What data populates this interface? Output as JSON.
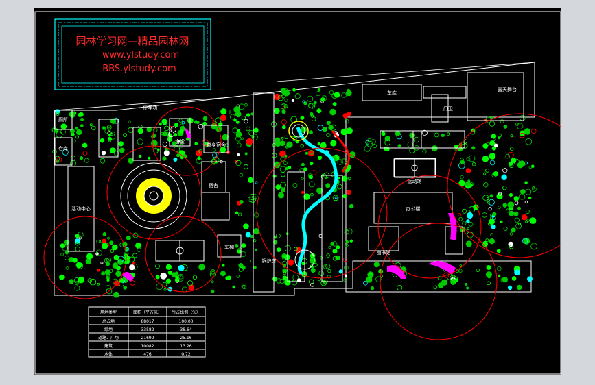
{
  "watermark": {
    "title": "园林学习网—精品园林网",
    "url1": "www.ylstudy.com",
    "url2": "BBS.ylstudy.com"
  },
  "labels": {
    "parking": "停车场",
    "office_building": "办公楼",
    "gate_guard": "门卫",
    "single_dorm": "单身宿舍",
    "cafeteria": "食堂",
    "library": "图书馆",
    "outdoor_stage": "露天舞台",
    "garage": "车库",
    "warehouse": "仓库",
    "toilet": "厕所",
    "bike_shed": "车棚",
    "activity_center": "活动中心",
    "boiler_room": "锅炉房",
    "dorm": "宿舍",
    "admin": "行政楼",
    "canteen": "餐厅",
    "lab": "实验楼",
    "sport": "运动场"
  },
  "land_use_table": {
    "headers": [
      "用地类型",
      "面积（平方米）",
      "所占比例（%）"
    ],
    "rows": [
      [
        "总占地",
        "88017",
        "100.00"
      ],
      [
        "绿地",
        "33582",
        "38.64"
      ],
      [
        "道路、广场",
        "21699",
        "25.16"
      ],
      [
        "建筑",
        "10082",
        "13.26"
      ],
      [
        "水体",
        "476",
        "0.72"
      ]
    ]
  },
  "colors": {
    "background": "#000000",
    "border": "#ffffff",
    "green": "#00ff00",
    "cyan": "#00ffff",
    "red": "#ff0000",
    "magenta": "#ff00ff",
    "yellow": "#ffff00"
  }
}
